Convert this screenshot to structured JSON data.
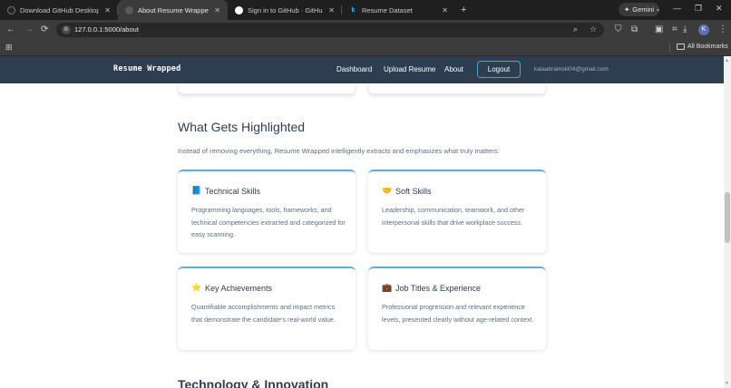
{
  "browser": {
    "tabs": [
      {
        "title": "Download GitHub Desktop | Gi",
        "active": false
      },
      {
        "title": "About Resume Wrapped - Fair",
        "active": true
      },
      {
        "title": "Sign in to GitHub · GitHub",
        "active": false
      },
      {
        "title": "Resume Dataset",
        "active": false
      }
    ],
    "new_tab": "+",
    "gemini_label": "Gemini",
    "url": "127.0.0.1:5000/about",
    "profile_initial": "K",
    "all_bookmarks": "All Bookmarks"
  },
  "site": {
    "brand": "Resume Wrapped",
    "nav": {
      "dashboard": "Dashboard",
      "upload": "Upload Resume",
      "about": "About",
      "logout": "Logout"
    },
    "user_email": "kaiaabramski04@gmail.com"
  },
  "section": {
    "title": "What Gets Highlighted",
    "intro": "Instead of removing everything, Resume Wrapped intelligently extracts and emphasizes what truly matters:",
    "cards": [
      {
        "icon": "books-icon",
        "emoji": "📘",
        "title": "Technical Skills",
        "text": "Programming languages, tools, frameworks, and technical competencies extracted and categorized for easy scanning."
      },
      {
        "icon": "handshake-icon",
        "emoji": "🤝",
        "title": "Soft Skills",
        "text": "Leadership, communication, teamwork, and other interpersonal skills that drive workplace success."
      },
      {
        "icon": "star-icon",
        "emoji": "⭐",
        "title": "Key Achievements",
        "text": "Quantifiable accomplishments and impact metrics that demonstrate the candidate's real-world value."
      },
      {
        "icon": "briefcase-icon",
        "emoji": "💼",
        "title": "Job Titles & Experience",
        "text": "Professional progression and relevant experience levels, presented clearly without age-related context."
      }
    ],
    "next_title": "Technology & Innovation"
  }
}
